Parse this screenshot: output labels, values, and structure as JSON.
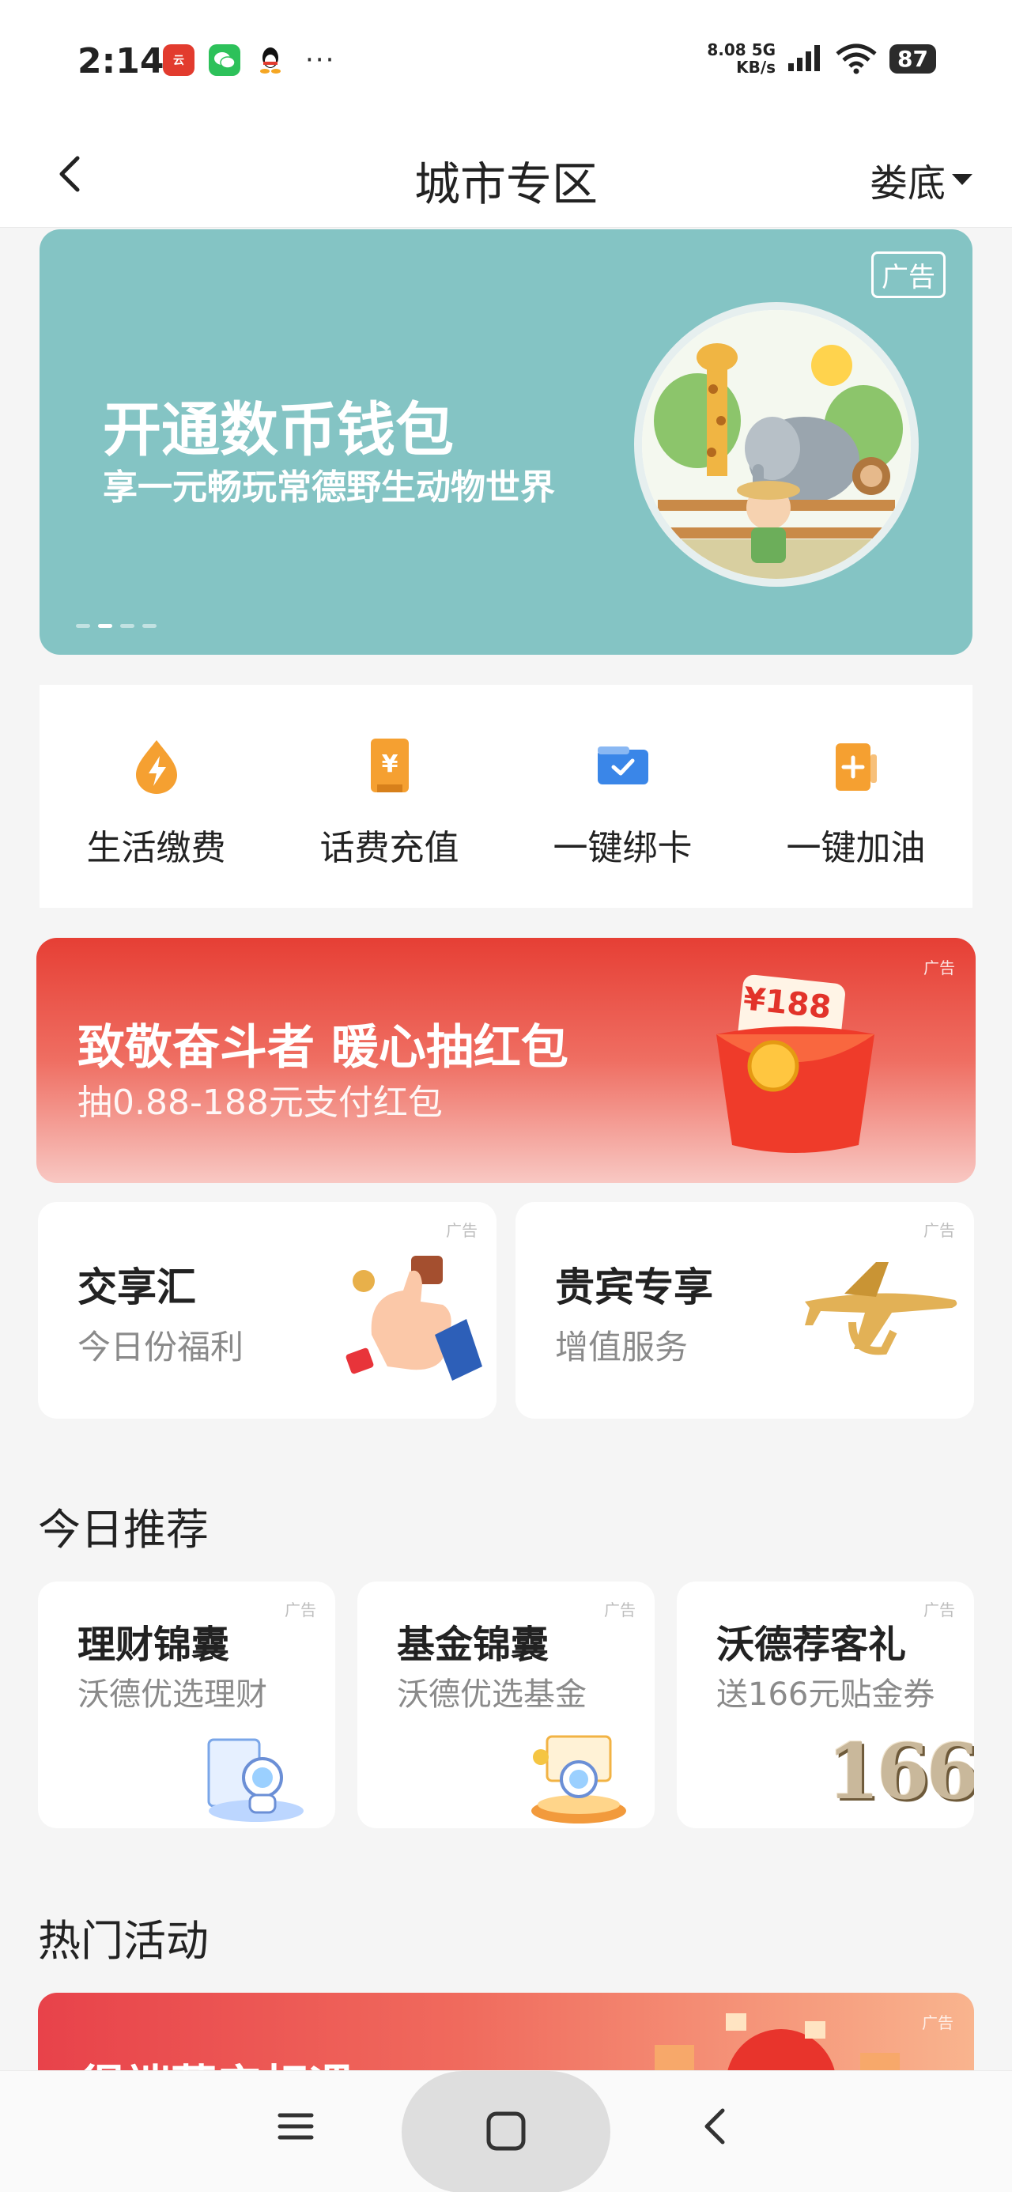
{
  "status_bar": {
    "time": "2:14",
    "net_speed_value": "8.08",
    "net_speed_unit": "KB/s",
    "network": "5G",
    "battery": "87",
    "more": "···"
  },
  "nav": {
    "title": "城市专区",
    "city": "娄底"
  },
  "banner": {
    "ad_tag": "广告",
    "title": "开通数币钱包",
    "subtitle": "享一元畅玩常德野生动物世界",
    "page_indicator": {
      "count": 4,
      "active_index": 1
    }
  },
  "shortcuts": [
    {
      "label": "生活缴费",
      "icon": "lightning-drop-icon",
      "glyph": "⚡"
    },
    {
      "label": "话费充值",
      "icon": "yuan-receipt-icon",
      "glyph": "¥"
    },
    {
      "label": "一键绑卡",
      "icon": "card-check-icon",
      "glyph": "✓"
    },
    {
      "label": "一键加油",
      "icon": "fuel-plus-icon",
      "glyph": "+"
    }
  ],
  "promo": {
    "ad_tag": "广告",
    "title": "致敬奋斗者 暖心抽红包",
    "subtitle": "抽0.88-188元支付红包",
    "amount_label": "¥188"
  },
  "feature_cards": [
    {
      "title": "交享汇",
      "subtitle": "今日份福利",
      "ad_tag": "广告"
    },
    {
      "title": "贵宾专享",
      "subtitle": "增值服务",
      "ad_tag": "广告"
    }
  ],
  "today": {
    "section_title": "今日推荐",
    "cards": [
      {
        "title": "理财锦囊",
        "subtitle": "沃德优选理财",
        "ad_tag": "广告"
      },
      {
        "title": "基金锦囊",
        "subtitle": "沃德优选基金",
        "ad_tag": "广告"
      },
      {
        "title": "沃德荐客礼",
        "subtitle": "送166元贴金券",
        "ad_tag": "广告",
        "badge": "166"
      }
    ]
  },
  "hot": {
    "section_title": "热门活动",
    "ad_tag": "广告",
    "partial_title": "得端蔓产相遇"
  },
  "colors": {
    "banner_bg": "#84c4c4",
    "promo_red": "#e63f35",
    "accent_orange": "#f5a031",
    "accent_blue": "#3a86e8"
  }
}
